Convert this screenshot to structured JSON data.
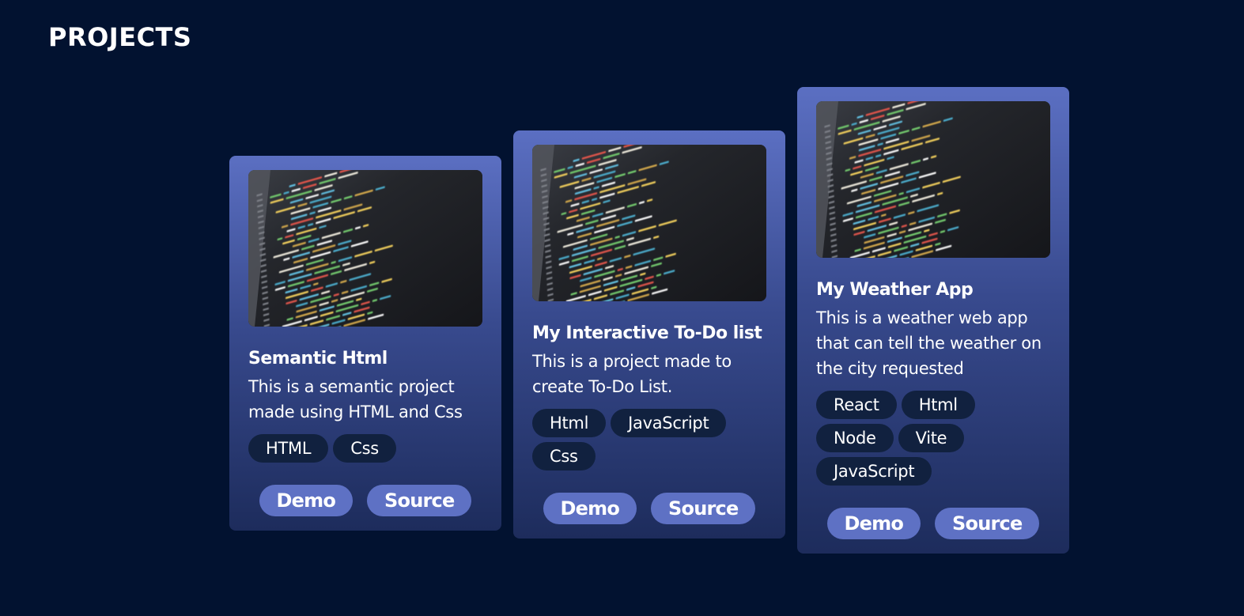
{
  "section": {
    "title": "PROJECTS"
  },
  "projects": [
    {
      "title": "Semantic Html",
      "description": "This is a semantic project made using HTML and Css",
      "tags": [
        "HTML",
        "Css"
      ],
      "demo_label": "Demo",
      "source_label": "Source"
    },
    {
      "title": "My Interactive To-Do list",
      "description": "This is a project made to create To-Do List.",
      "tags": [
        "Html",
        "JavaScript",
        "Css"
      ],
      "demo_label": "Demo",
      "source_label": "Source"
    },
    {
      "title": "My Weather App",
      "description": "This is a weather web app that can tell the weather on the city requested",
      "tags": [
        "React",
        "Html",
        "Node",
        "Vite",
        "JavaScript"
      ],
      "demo_label": "Demo",
      "source_label": "Source"
    }
  ],
  "colors": {
    "background": "#021230",
    "card_top": "#5b6fc2",
    "card_bottom": "#1d2c5c",
    "tag": "#11213f",
    "button": "#5e71c4"
  }
}
